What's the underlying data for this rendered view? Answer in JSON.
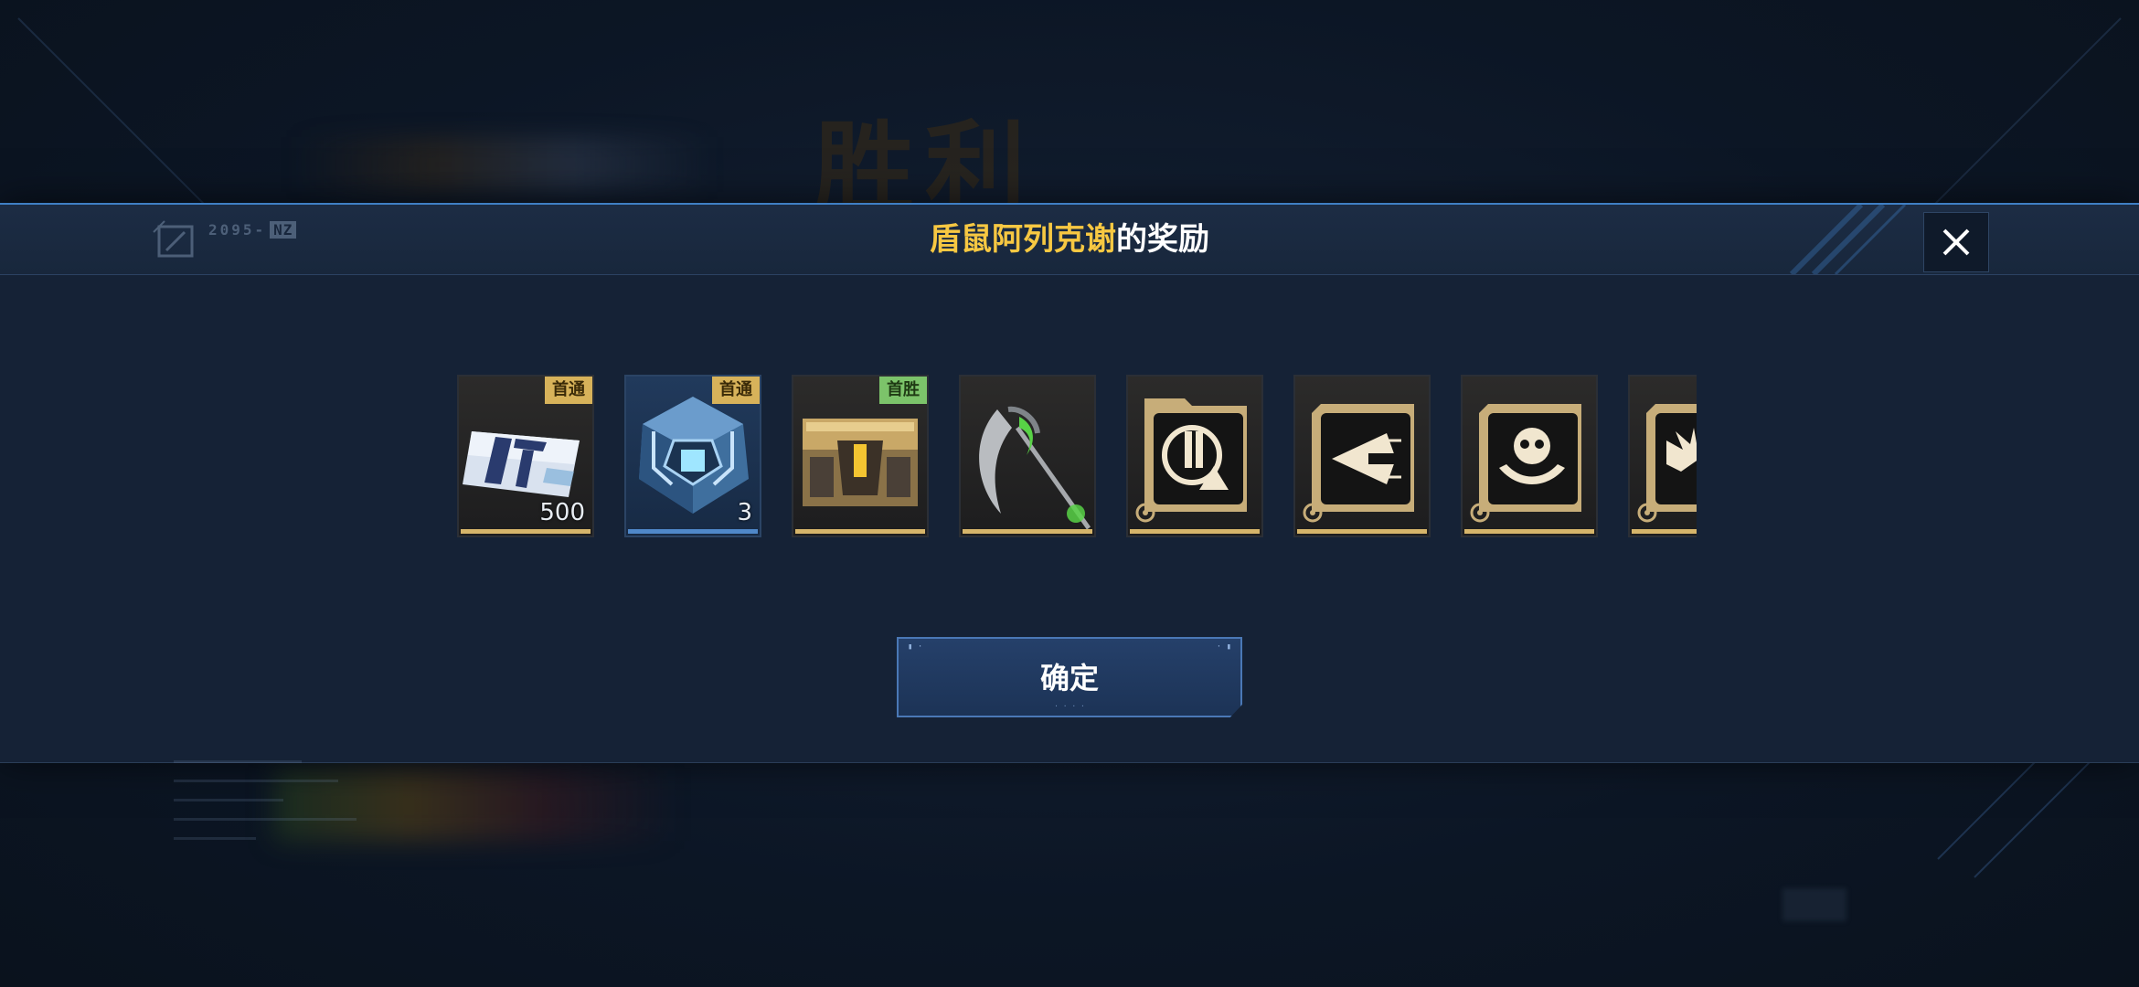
{
  "background": {
    "victory_text": "胜利"
  },
  "modal": {
    "title_highlight": "盾鼠阿列克谢",
    "title_rest": "的奖励",
    "logo_text": "2095-",
    "logo_tag": "NZ",
    "close_icon": "close-icon"
  },
  "rewards": [
    {
      "name": "currency-ticket",
      "icon": "ticket-icon",
      "quantity": "500",
      "badge": "首通",
      "badge_color": "#d7b25a",
      "rarity": "gold"
    },
    {
      "name": "blue-crystal-core",
      "icon": "crystal-core-icon",
      "quantity": "3",
      "badge": "首通",
      "badge_color": "#d7b25a",
      "rarity": "blue"
    },
    {
      "name": "supply-chest",
      "icon": "chest-icon",
      "quantity": "",
      "badge": "首胜",
      "badge_color": "#7cc36a",
      "rarity": "gold"
    },
    {
      "name": "scythe-weapon",
      "icon": "scythe-icon",
      "quantity": "",
      "badge": "",
      "rarity": "gold"
    },
    {
      "name": "ammo-module-card",
      "icon": "ammo-icon",
      "quantity": "",
      "badge": "",
      "rarity": "gold"
    },
    {
      "name": "missile-module-card",
      "icon": "missile-icon",
      "quantity": "",
      "badge": "",
      "rarity": "gold"
    },
    {
      "name": "skull-module-card",
      "icon": "skull-icon",
      "quantity": "",
      "badge": "",
      "rarity": "gold"
    },
    {
      "name": "partial-module-card",
      "icon": "burst-icon",
      "quantity": "",
      "badge": "",
      "rarity": "gold"
    }
  ],
  "confirm_button": {
    "label": "确定"
  },
  "colors": {
    "accent_blue": "#3f7fc4",
    "title_highlight": "#f7c842",
    "gold_bar": "#d6b56a",
    "blue_bar": "#4f88c9"
  }
}
